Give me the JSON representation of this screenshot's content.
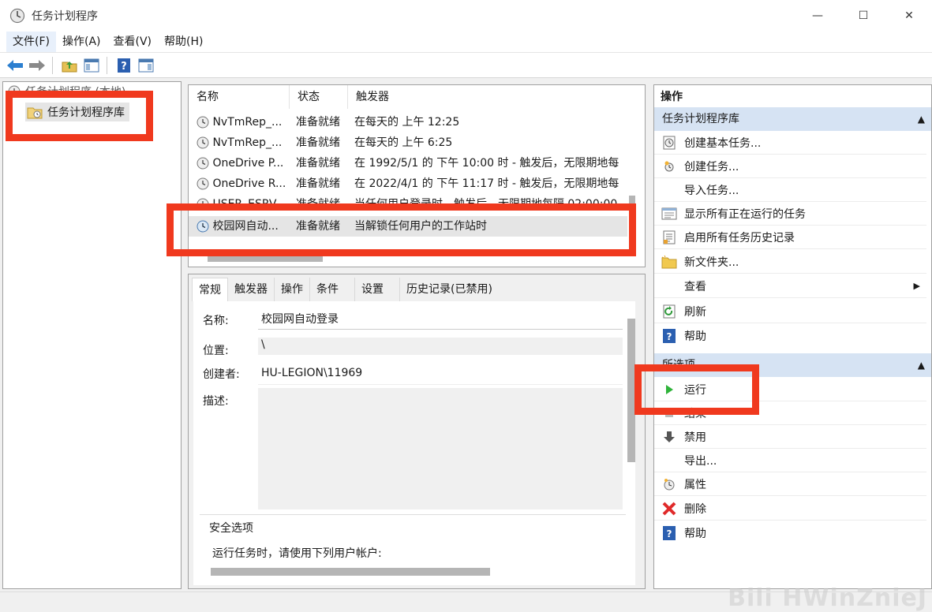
{
  "window": {
    "title": "任务计划程序",
    "minimize": "—",
    "maximize": "☐",
    "close": "✕"
  },
  "menu": [
    "文件(F)",
    "操作(A)",
    "查看(V)",
    "帮助(H)"
  ],
  "toolbar": {
    "icons": [
      "back-arrow-icon",
      "forward-arrow-icon",
      "folder-up-icon",
      "show-hide-tree-icon",
      "help-icon",
      "show-hide-action-pane-icon"
    ]
  },
  "tree": {
    "root": "任务计划程序 (本地)",
    "library": "任务计划程序库"
  },
  "task_list": {
    "columns": [
      "名称",
      "状态",
      "触发器"
    ],
    "rows": [
      {
        "name": "NvTmRep_...",
        "status": "准备就绪",
        "trigger": "在每天的 上午 12:25"
      },
      {
        "name": "NvTmRep_...",
        "status": "准备就绪",
        "trigger": "在每天的 上午 6:25"
      },
      {
        "name": "OneDrive P...",
        "status": "准备就绪",
        "trigger": "在 1992/5/1 的 下午 10:00 时 - 触发后，无限期地每"
      },
      {
        "name": "OneDrive R...",
        "status": "准备就绪",
        "trigger": "在 2022/4/1 的 下午 11:17 时 - 触发后，无限期地每"
      },
      {
        "name": "USER_ESRV...",
        "status": "准备就绪",
        "trigger": "当任何用户登录时 - 触发后，无限期地每隔 02:00:00"
      },
      {
        "name": "校园网自动...",
        "status": "准备就绪",
        "trigger": "当解锁任何用户的工作站时"
      }
    ]
  },
  "details": {
    "tabs": [
      "常规",
      "触发器",
      "操作",
      "条件",
      "设置",
      "历史记录(已禁用)"
    ],
    "name_label": "名称:",
    "name_value": "校园网自动登录",
    "location_label": "位置:",
    "location_value": "\\",
    "author_label": "创建者:",
    "author_value": "HU-LEGION\\11969",
    "description_label": "描述:",
    "security_title": "安全选项",
    "security_text": "运行任务时，请使用下列用户帐户:"
  },
  "actions": {
    "title": "操作",
    "section1": "任务计划程序库",
    "section1_items": [
      {
        "label": "创建基本任务...",
        "icon": "create-basic-task-icon"
      },
      {
        "label": "创建任务...",
        "icon": "create-task-icon"
      },
      {
        "label": "导入任务...",
        "icon": ""
      },
      {
        "label": "显示所有正在运行的任务",
        "icon": "running-tasks-icon"
      },
      {
        "label": "启用所有任务历史记录",
        "icon": "history-icon"
      },
      {
        "label": "新文件夹...",
        "icon": "new-folder-icon"
      },
      {
        "label": "查看",
        "icon": ""
      },
      {
        "label": "刷新",
        "icon": "refresh-icon"
      },
      {
        "label": "帮助",
        "icon": "help-icon"
      }
    ],
    "section2": "所选项",
    "section2_items": [
      {
        "label": "运行",
        "icon": "run-icon"
      },
      {
        "label": "结束",
        "icon": "end-icon"
      },
      {
        "label": "禁用",
        "icon": "disable-icon"
      },
      {
        "label": "导出...",
        "icon": ""
      },
      {
        "label": "属性",
        "icon": "properties-icon"
      },
      {
        "label": "删除",
        "icon": "delete-icon"
      },
      {
        "label": "帮助",
        "icon": "help-icon"
      }
    ]
  },
  "watermark": "Bili HWinZnieJ",
  "colors": {
    "highlight_red": "#f0391e",
    "section_header": "#d6e3f3",
    "selected_row": "#e5e5e5"
  }
}
